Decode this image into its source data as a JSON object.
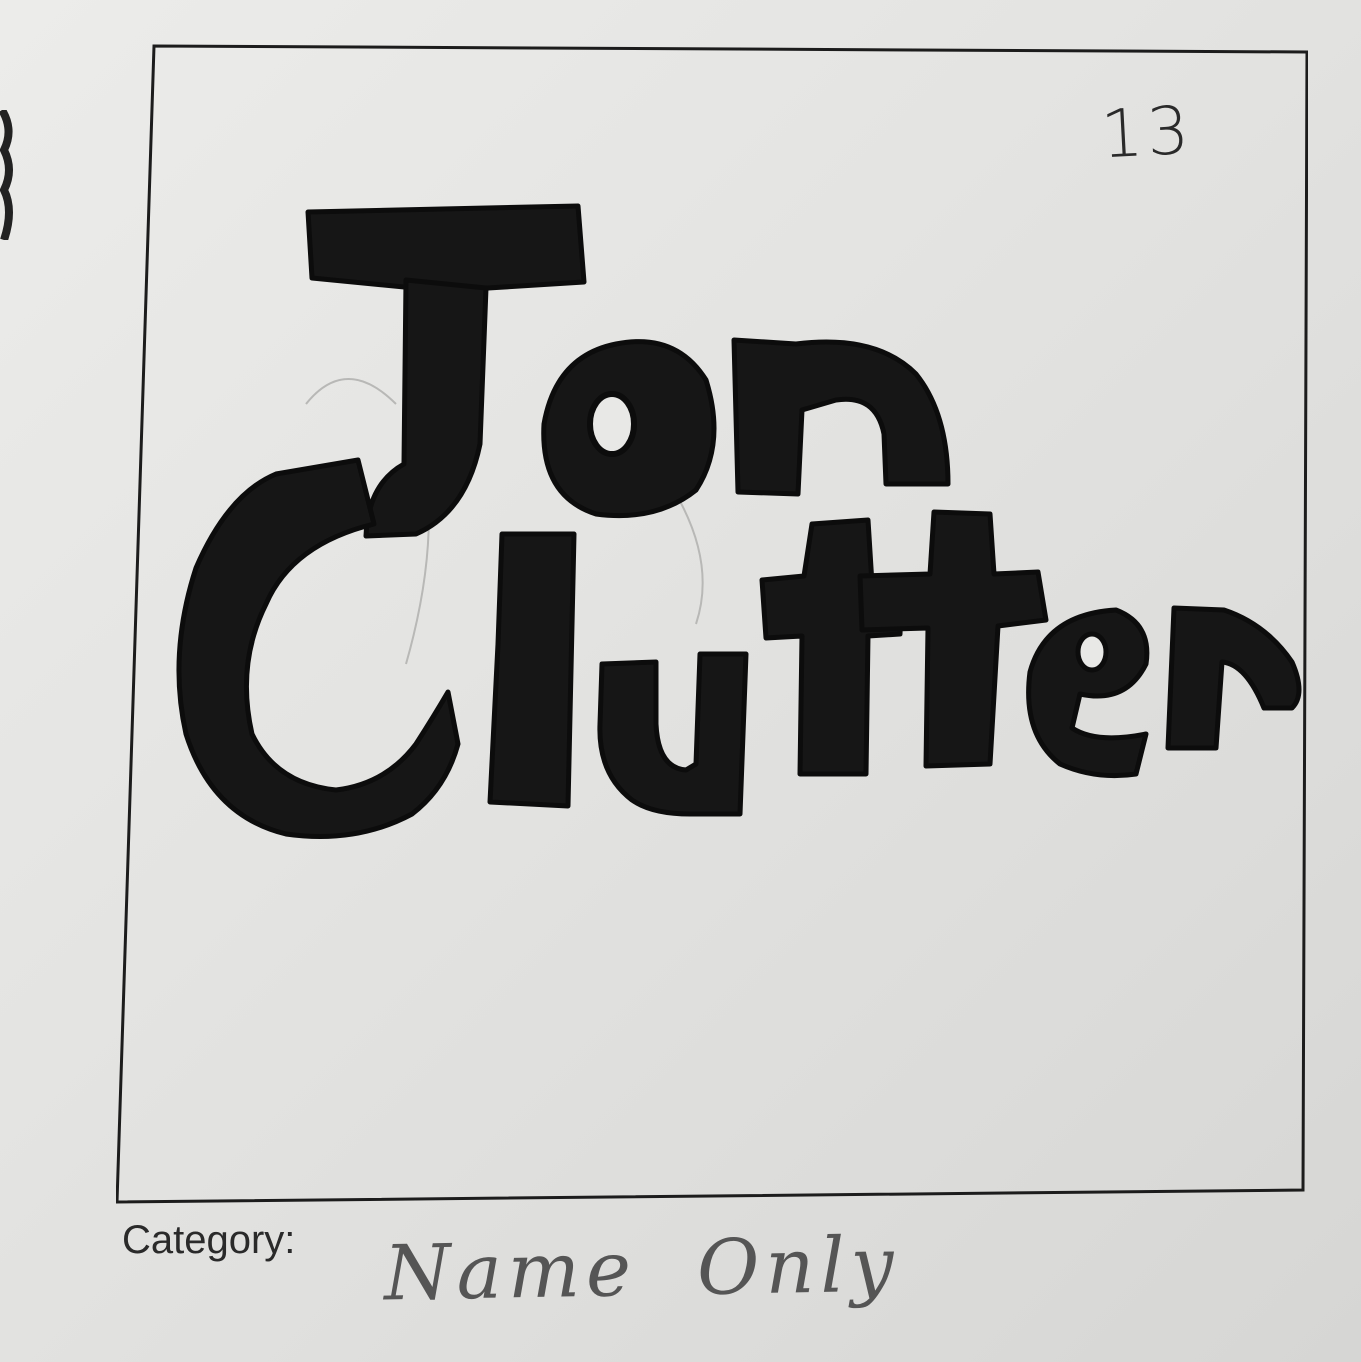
{
  "sheet": {
    "page_number": "13",
    "category_label": "Category:",
    "category_value": "Name Only"
  },
  "artwork": {
    "description_lines": [
      "Jon",
      "Clutter"
    ],
    "ink_color": "#161616",
    "paper_color": "#e8e8e6"
  }
}
